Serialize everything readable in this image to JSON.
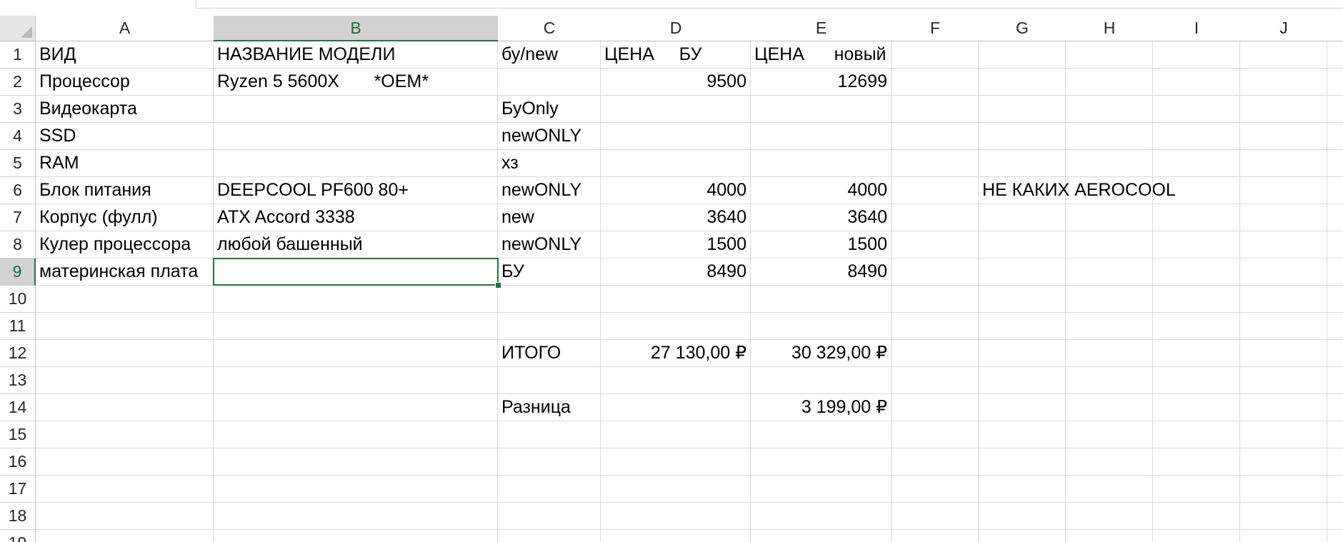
{
  "columns": [
    "A",
    "B",
    "C",
    "D",
    "E",
    "F",
    "G",
    "H",
    "I",
    "J"
  ],
  "rows": [
    "1",
    "2",
    "3",
    "4",
    "5",
    "6",
    "7",
    "8",
    "9",
    "10",
    "11",
    "12",
    "13",
    "14",
    "15",
    "16",
    "17",
    "18",
    "19"
  ],
  "active_cell": {
    "column": "B",
    "row": "9"
  },
  "cells": {
    "A1": "ВИД",
    "B1": "НАЗВАНИЕ МОДЕЛИ",
    "C1": "бу/new",
    "D1": "ЦЕНА     БУ",
    "E1": "ЦЕНА      новый",
    "A2": "Процессор",
    "B2": "Ryzen 5 5600X       *OEM*",
    "D2": "9500",
    "E2": "12699",
    "A3": "Видеокарта",
    "C3": "БуOnly",
    "A4": "SSD",
    "C4": "newONLY",
    "A5": "RAM",
    "C5": "хз",
    "A6": "Блок питания",
    "B6": "DEEPCOOL PF600 80+",
    "C6": "newONLY",
    "D6": "4000",
    "E6": "4000",
    "G6": "НЕ КАКИХ AEROCOOL",
    "A7": "Корпус (фулл)",
    "B7": "ATX Accord 3338",
    "C7": "new",
    "D7": "3640",
    "E7": "3640",
    "A8": "Кулер процессора",
    "B8": "любой башенный",
    "C8": "newONLY",
    "D8": "1500",
    "E8": "1500",
    "A9": "материнская плата",
    "C9": "БУ",
    "D9": "8490",
    "E9": "8490",
    "C12": "ИТОГО",
    "D12": "27 130,00 ₽",
    "E12": "30 329,00 ₽",
    "C14": "Разница",
    "E14": "3 199,00 ₽"
  },
  "colors": {
    "accent": "#217346",
    "header_active_bg": "#d2d2d2",
    "gridline": "#dadada"
  }
}
